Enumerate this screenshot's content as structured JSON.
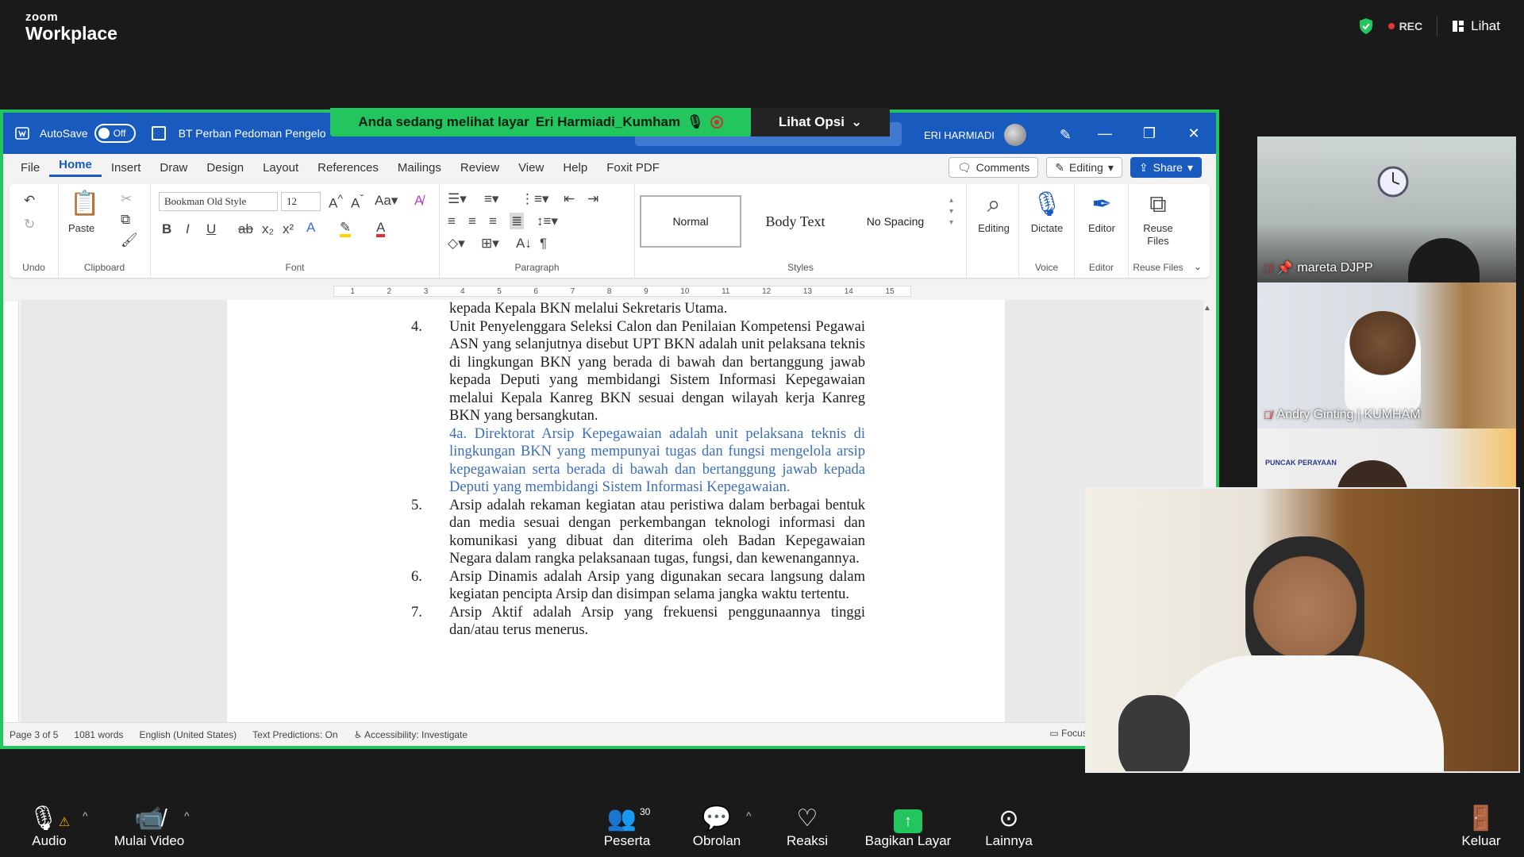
{
  "zoom": {
    "brand_top": "zoom",
    "brand_bottom": "Workplace",
    "rec_label": "REC",
    "view_label": "Lihat",
    "banner_text": "Anda sedang melihat layar",
    "banner_user": "Eri Harmiadi_Kumham",
    "options_label": "Lihat Opsi",
    "bottom": {
      "audio": "Audio",
      "video": "Mulai Video",
      "participants": "Peserta",
      "participants_count": "30",
      "chat": "Obrolan",
      "react": "Reaksi",
      "share": "Bagikan Layar",
      "more": "Lainnya",
      "leave": "Keluar"
    },
    "tiles": [
      {
        "name": "mareta DJPP"
      },
      {
        "name": "Andry Ginting | KUMHAM"
      },
      {
        "name": ""
      }
    ],
    "tile3_sign": "PUNCAK PERAYAAN"
  },
  "word": {
    "autosave_label": "AutoSave",
    "autosave_state": "Off",
    "doc_title": "BT Perban Pedoman Pengelo",
    "user_name": "ERI HARMIADI",
    "menu": [
      "File",
      "Home",
      "Insert",
      "Draw",
      "Design",
      "Layout",
      "References",
      "Mailings",
      "Review",
      "View",
      "Help",
      "Foxit PDF"
    ],
    "comments_label": "Comments",
    "editing_label": "Editing",
    "share_label": "Share",
    "ribbon": {
      "undo_label": "Undo",
      "paste_label": "Paste",
      "clipboard_label": "Clipboard",
      "font_name": "Bookman Old Style",
      "font_size": "12",
      "font_label": "Font",
      "paragraph_label": "Paragraph",
      "styles": [
        "Normal",
        "Body Text",
        "No Spacing"
      ],
      "styles_label": "Styles",
      "editing_btn": "Editing",
      "dictate_btn": "Dictate",
      "voice_label": "Voice",
      "editor_btn": "Editor",
      "editor_label": "Editor",
      "reuse_btn": "Reuse Files",
      "reuse_label": "Reuse Files"
    },
    "ruler_numbers": [
      "1",
      "2",
      "3",
      "4",
      "5",
      "6",
      "7",
      "8",
      "9",
      "10",
      "11",
      "12",
      "13",
      "14",
      "15"
    ],
    "document": {
      "line0": "kepada Kepala BKN melalui Sekretaris Utama.",
      "p4_num": "4.",
      "p4": "Unit Penyelenggara Seleksi Calon dan Penilaian Kompetensi Pegawai ASN yang selanjutnya disebut UPT BKN adalah unit pelaksana teknis di lingkungan BKN yang berada di bawah dan bertanggung jawab kepada Deputi yang membidangi Sistem Informasi Kepegawaian melalui Kepala Kanreg BKN sesuai dengan wilayah kerja Kanreg BKN yang bersangkutan.",
      "p4a": "4a. Direktorat Arsip Kepegawaian adalah unit pelaksana teknis di lingkungan BKN yang mempunyai tugas dan fungsi mengelola arsip kepegawaian serta berada di bawah dan bertanggung jawab kepada Deputi yang membidangi Sistem Informasi Kepegawaian.",
      "p5_num": "5.",
      "p5": "Arsip adalah rekaman kegiatan atau peristiwa dalam berbagai bentuk dan media sesuai dengan perkembangan teknologi informasi dan komunikasi yang dibuat dan diterima oleh Badan Kepegawaian Negara dalam rangka pelaksanaan tugas, fungsi, dan kewenangannya.",
      "p6_num": "6.",
      "p6": "Arsip Dinamis adalah Arsip yang digunakan secara langsung dalam kegiatan pencipta Arsip dan disimpan selama jangka waktu tertentu.",
      "p7_num": "7.",
      "p7": "Arsip Aktif adalah Arsip yang frekuensi penggunaannya tinggi dan/atau terus menerus."
    },
    "status": {
      "page": "Page 3 of 5",
      "words": "1081 words",
      "language": "English (United States)",
      "predictions": "Text Predictions: On",
      "accessibility": "Accessibility: Investigate",
      "focus": "Focus"
    }
  }
}
